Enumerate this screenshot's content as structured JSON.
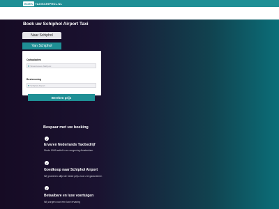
{
  "header": {
    "logo_part1": "BOEK",
    "logo_part2": "TAXISCHIPHOL.NL"
  },
  "hero": {
    "title": "Boek uw Schiphol Airport Taxi"
  },
  "booking": {
    "tab_to": "Naar Schiphol",
    "tab_from": "Van Schiphol",
    "pickup_label": "Ophaaladres",
    "pickup_placeholder": "Straat Hoeve Nabij etc",
    "destination_label": "Bestemming",
    "destination_value": "Schiphol Airport",
    "calculate_button": "Bereken prijs"
  },
  "benefits": {
    "title": "Bespaar met uw boeking",
    "items": [
      {
        "title": "Ervaren Nederlands Taxibedrijf",
        "text": "Sinds 1999 actief in en omgeving Amsterdam"
      },
      {
        "title": "Goedkoop naar Schiphol Airport",
        "text": "Wij proberen altijd de beste prijs voor u te garanderen"
      },
      {
        "title": "Betaalbare en luxe voertuigen",
        "text": "Wij zorgen voor een luxe ervaring"
      }
    ]
  },
  "icons": {
    "pin": "map-pin-icon",
    "check": "check-circle-icon"
  },
  "colors": {
    "accent": "#1f8f95",
    "hero_dark": "#160b24",
    "hero_teal": "#0b6e78"
  }
}
